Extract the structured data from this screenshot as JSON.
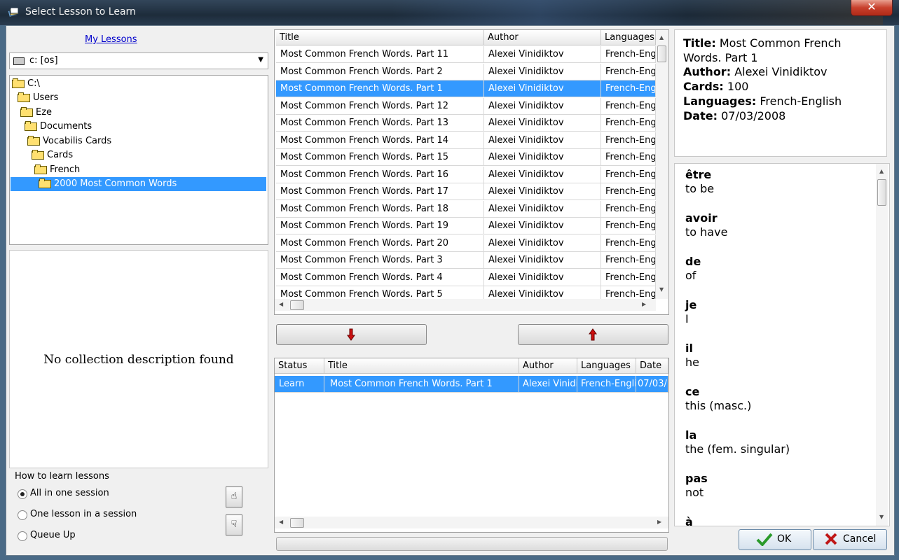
{
  "window": {
    "title": "Select Lesson to Learn",
    "close_glyph": "✕"
  },
  "left": {
    "my_lessons_link": "My Lessons",
    "drive": {
      "label": "c: [os]",
      "icon": "drive-icon"
    },
    "tree": [
      {
        "label": "C:\\",
        "depth": 0
      },
      {
        "label": "Users",
        "depth": 1
      },
      {
        "label": "Eze",
        "depth": 2
      },
      {
        "label": "Documents",
        "depth": 3
      },
      {
        "label": "Vocabilis Cards",
        "depth": 4
      },
      {
        "label": "Cards",
        "depth": 5
      },
      {
        "label": "French",
        "depth": 6
      },
      {
        "label": "2000 Most Common Words",
        "depth": 7,
        "selected": true
      }
    ],
    "description": "No collection description found",
    "how_to": {
      "title": "How to learn lessons",
      "options": [
        {
          "label": "All in one session",
          "checked": true
        },
        {
          "label": "One lesson in a session",
          "checked": false
        },
        {
          "label": "Queue Up",
          "checked": false
        }
      ]
    }
  },
  "lessons_table": {
    "columns": [
      "Title",
      "Author",
      "Languages"
    ],
    "rows": [
      [
        "Most Common French Words. Part 11",
        "Alexei Vinidiktov",
        "French-Eng"
      ],
      [
        "Most Common French Words. Part 2",
        "Alexei Vinidiktov",
        "French-Eng"
      ],
      [
        "Most Common French Words. Part 1",
        "Alexei Vinidiktov",
        "French-Eng"
      ],
      [
        "Most Common French Words. Part 12",
        "Alexei Vinidiktov",
        "French-Eng"
      ],
      [
        "Most Common French Words. Part 13",
        "Alexei Vinidiktov",
        "French-Eng"
      ],
      [
        "Most Common French Words. Part 14",
        "Alexei Vinidiktov",
        "French-Eng"
      ],
      [
        "Most Common French Words. Part 15",
        "Alexei Vinidiktov",
        "French-Eng"
      ],
      [
        "Most Common French Words. Part 16",
        "Alexei Vinidiktov",
        "French-Eng"
      ],
      [
        "Most Common French Words. Part 17",
        "Alexei Vinidiktov",
        "French-Eng"
      ],
      [
        "Most Common French Words. Part 18",
        "Alexei Vinidiktov",
        "French-Eng"
      ],
      [
        "Most Common French Words. Part 19",
        "Alexei Vinidiktov",
        "French-Eng"
      ],
      [
        "Most Common French Words. Part 20",
        "Alexei Vinidiktov",
        "French-Eng"
      ],
      [
        "Most Common French Words. Part 3",
        "Alexei Vinidiktov",
        "French-Eng"
      ],
      [
        "Most Common French Words. Part 4",
        "Alexei Vinidiktov",
        "French-Eng"
      ],
      [
        "Most Common French Words. Part 5",
        "Alexei Vinidiktov",
        "French-Eng"
      ]
    ],
    "selected_index": 2
  },
  "move_buttons": {
    "down_icon": "red-arrow-down-icon",
    "up_icon": "red-arrow-up-icon"
  },
  "queue_table": {
    "columns": [
      "Status",
      "Title",
      "Author",
      "Languages",
      "Date"
    ],
    "rows": [
      [
        "Learn",
        "Most Common French Words. Part 1",
        "Alexei Vinidik",
        "French-Englis",
        "07/03/"
      ]
    ],
    "selected_index": 0
  },
  "info": {
    "title_label": "Title:",
    "title_value": "Most Common French Words. Part 1",
    "author_label": "Author:",
    "author_value": "Alexei Vinidiktov",
    "cards_label": "Cards:",
    "cards_value": "100",
    "languages_label": "Languages:",
    "languages_value": "French-English",
    "date_label": "Date:",
    "date_value": "07/03/2008"
  },
  "words": [
    {
      "fr": "être",
      "en": "to be"
    },
    {
      "fr": "avoir",
      "en": "to have"
    },
    {
      "fr": "de",
      "en": "of"
    },
    {
      "fr": "je",
      "en": "I"
    },
    {
      "fr": "il",
      "en": "he"
    },
    {
      "fr": "ce",
      "en": "this (masc.)"
    },
    {
      "fr": "la",
      "en": "the (fem. singular)"
    },
    {
      "fr": "pas",
      "en": "not"
    },
    {
      "fr": "à",
      "en": ""
    }
  ],
  "buttons": {
    "ok": "OK",
    "cancel": "Cancel"
  },
  "colors": {
    "selection": "#3399ff",
    "link": "#0000cc",
    "arrow_red": "#cc1010",
    "ok_check": "#2a9a2a",
    "cancel_x": "#c01818"
  }
}
